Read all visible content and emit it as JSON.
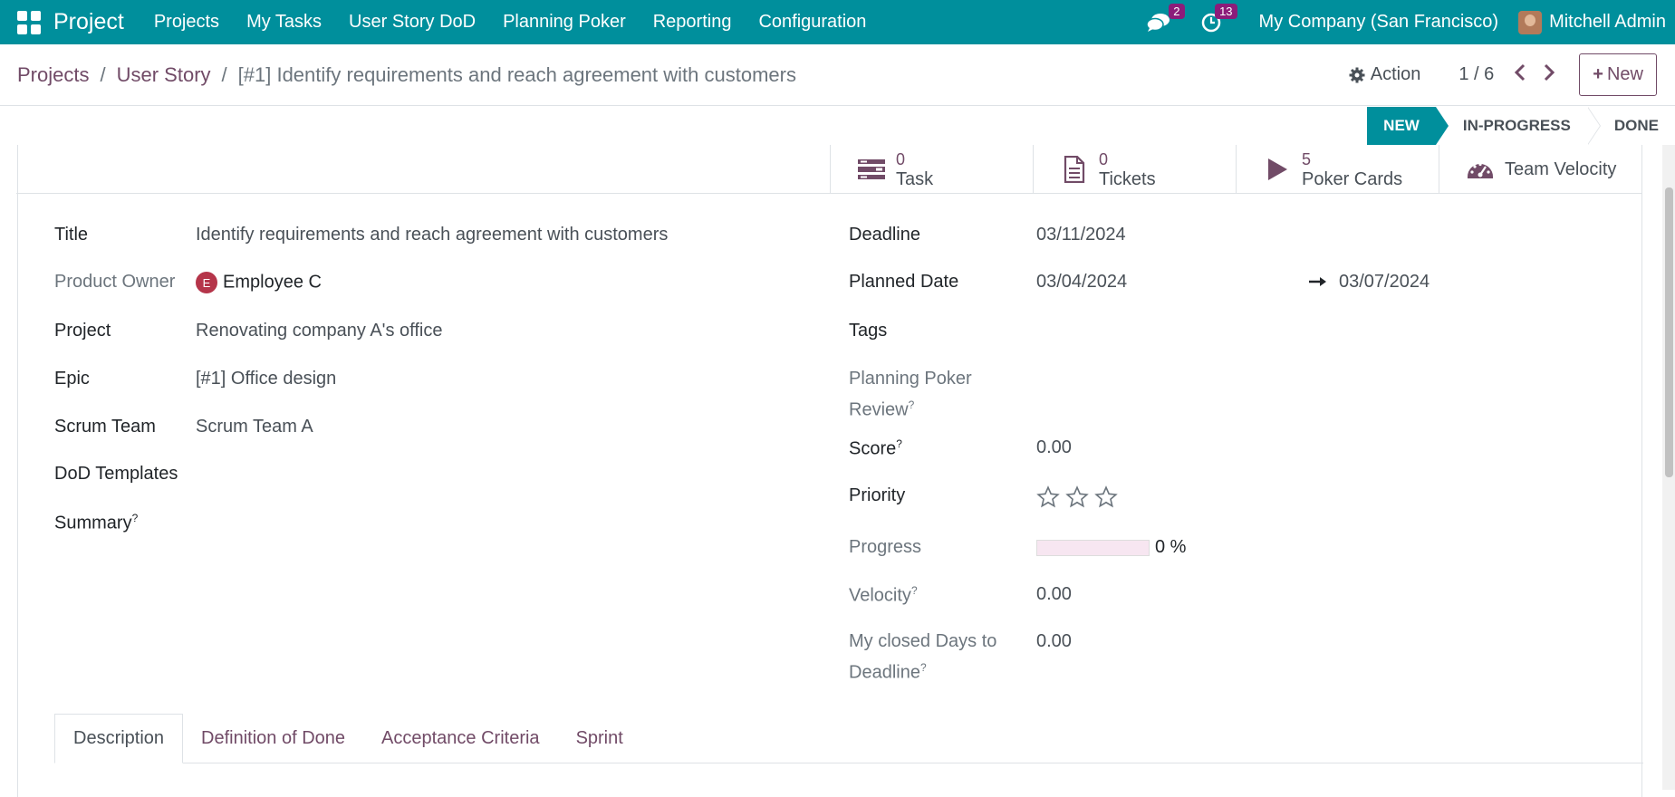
{
  "navbar": {
    "brand": "Project",
    "menu": [
      "Projects",
      "My Tasks",
      "User Story DoD",
      "Planning Poker",
      "Reporting",
      "Configuration"
    ],
    "messages_count": "2",
    "activities_count": "13",
    "company": "My Company (San Francisco)",
    "user": "Mitchell Admin"
  },
  "breadcrumb": {
    "items": [
      "Projects",
      "User Story"
    ],
    "current": "[#1] Identify requirements and reach agreement with customers"
  },
  "controls": {
    "action_label": "Action",
    "pager": "1 / 6",
    "new_label": "New"
  },
  "status": {
    "stages": [
      "NEW",
      "IN-PROGRESS",
      "DONE"
    ],
    "active": "NEW"
  },
  "smart_buttons": [
    {
      "value": "0",
      "label": "Task",
      "icon": "tasks-icon"
    },
    {
      "value": "0",
      "label": "Tickets",
      "icon": "file-text-icon"
    },
    {
      "value": "5",
      "label": "Poker Cards",
      "icon": "play-icon"
    },
    {
      "value": "",
      "label": "Team Velocity",
      "icon": "dashboard-icon"
    }
  ],
  "left_fields": {
    "title_label": "Title",
    "title_value": "Identify requirements and reach agreement with customers",
    "owner_label": "Product Owner",
    "owner_initial": "E",
    "owner_value": "Employee C",
    "project_label": "Project",
    "project_value": "Renovating company A's office",
    "epic_label": "Epic",
    "epic_value": "[#1] Office design",
    "team_label": "Scrum Team",
    "team_value": "Scrum Team A",
    "dod_label": "DoD Templates",
    "summary_label": "Summary"
  },
  "right_fields": {
    "deadline_label": "Deadline",
    "deadline_value": "03/11/2024",
    "planned_label": "Planned Date",
    "planned_start": "03/04/2024",
    "planned_end": "03/07/2024",
    "tags_label": "Tags",
    "poker_review_label_1": "Planning Poker",
    "poker_review_label_2": "Review",
    "score_label": "Score",
    "score_value": "0.00",
    "priority_label": "Priority",
    "priority_stars": 0,
    "priority_max": 3,
    "progress_label": "Progress",
    "progress_value": 0,
    "progress_text": "0 %",
    "velocity_label": "Velocity",
    "velocity_value": "0.00",
    "closed_days_label_1": "My closed Days to",
    "closed_days_label_2": "Deadline",
    "closed_days_value": "0.00"
  },
  "help_marker": "?",
  "tabs": [
    "Description",
    "Definition of Done",
    "Acceptance Criteria",
    "Sprint"
  ],
  "colors": {
    "navbar": "#008f9c",
    "accent": "#714b67",
    "badge": "#8c1c7a"
  }
}
